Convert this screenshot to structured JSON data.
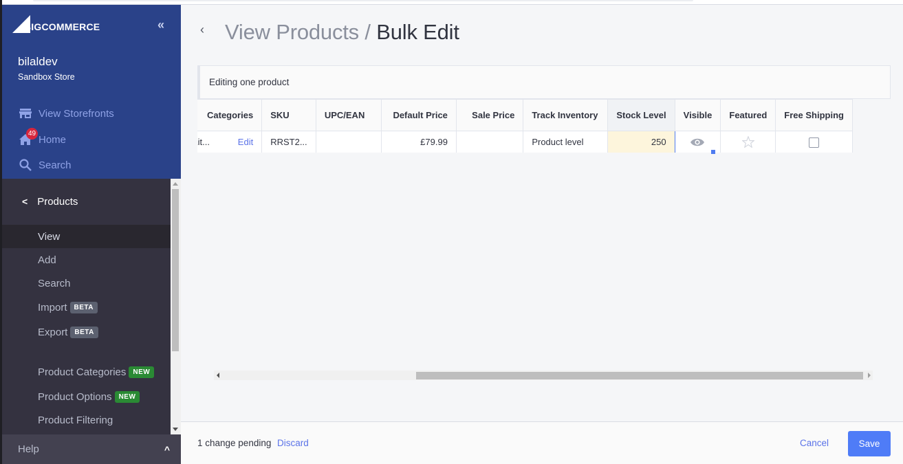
{
  "sidebar": {
    "brand": "BIGCOMMERCE",
    "store_name": "bilaldev",
    "store_type": "Sandbox Store",
    "collapse_icon": "double-chevron-left-icon",
    "links": [
      {
        "label": "View Storefronts",
        "icon": "storefront-icon"
      },
      {
        "label": "Home",
        "icon": "home-icon",
        "badge": "49"
      },
      {
        "label": "Search",
        "icon": "search-icon"
      }
    ],
    "section_title": "Products",
    "items": [
      {
        "label": "View",
        "active": true
      },
      {
        "label": "Add"
      },
      {
        "label": "Search"
      },
      {
        "label": "Import",
        "tag": "BETA"
      },
      {
        "label": "Export",
        "tag": "BETA"
      },
      {
        "label": "Product Categories",
        "tag": "NEW"
      },
      {
        "label": "Product Options",
        "tag": "NEW"
      },
      {
        "label": "Product Filtering"
      }
    ],
    "help_label": "Help"
  },
  "header": {
    "breadcrumb": "View Products",
    "separator": "/",
    "title": "Bulk Edit"
  },
  "notice": "Editing one product",
  "grid": {
    "columns": [
      "Categories",
      "SKU",
      "UPC/EAN",
      "Default Price",
      "Sale Price",
      "Track Inventory",
      "Stock Level",
      "Visible",
      "Featured",
      "Free Shipping"
    ],
    "rows": [
      {
        "categories": "Bath, Kit...",
        "categories_action": "Edit",
        "sku": "RRST2...",
        "upc": "",
        "default_price": "£79.99",
        "sale_price": "",
        "track_inventory": "Product level",
        "stock_level": "250",
        "visible": true,
        "featured": false,
        "free_shipping": false
      }
    ]
  },
  "footer": {
    "pending": "1 change pending",
    "discard": "Discard",
    "cancel": "Cancel",
    "save": "Save"
  },
  "colors": {
    "sidebar_blue": "#2a4289",
    "sidebar_dark": "#343240",
    "accent": "#4f7cf7",
    "badge_red": "#d7263d",
    "new_green": "#2a8a34",
    "edited_cell": "#fdf5dc"
  }
}
